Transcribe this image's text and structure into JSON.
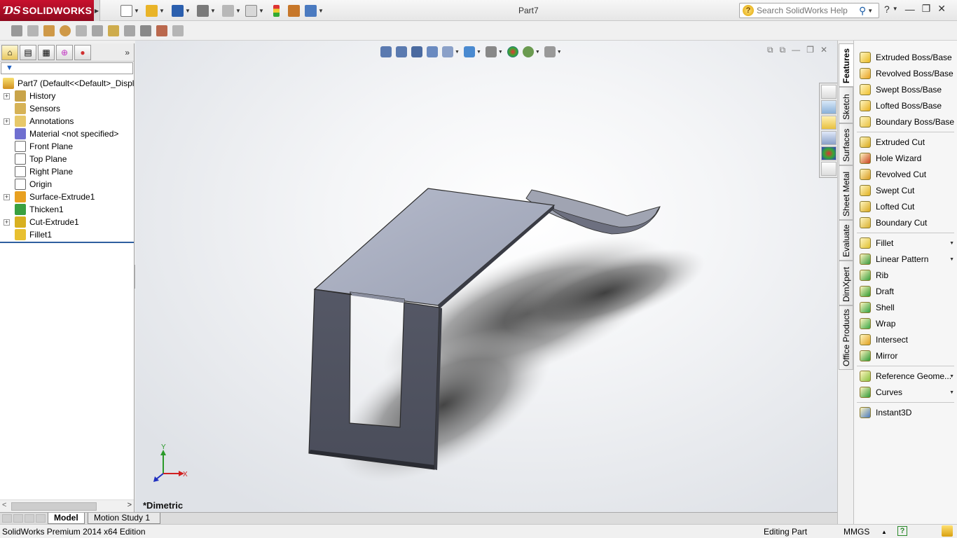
{
  "app": {
    "brand": "SOLIDWORKS",
    "document_title": "Part7",
    "search_placeholder": "Search SolidWorks Help"
  },
  "title_toolbar": [
    {
      "name": "new-document-icon",
      "color": "#ffffff"
    },
    {
      "name": "open-folder-icon",
      "color": "#e9b428"
    },
    {
      "name": "save-icon",
      "color": "#2b5fae"
    },
    {
      "name": "print-icon",
      "color": "#7a7a7a"
    },
    {
      "name": "undo-icon",
      "color": "#9a9a9a"
    },
    {
      "name": "select-cursor-icon",
      "color": "#d8d8d8"
    },
    {
      "name": "rebuild-traffic-light-icon",
      "color": "#3f9f3f"
    },
    {
      "name": "file-properties-icon",
      "color": "#c7772a"
    },
    {
      "name": "options-icon",
      "color": "#4a7ac0"
    }
  ],
  "feature_manager": {
    "tabs": [
      "feature-manager-tab",
      "property-manager-tab",
      "configuration-manager-tab",
      "dimxpert-manager-tab",
      "display-manager-tab"
    ],
    "root": "Part7  (Default<<Default>_Displ",
    "tree": [
      {
        "label": "History",
        "icon": "history-icon",
        "expandable": true,
        "color": "#c9a44a"
      },
      {
        "label": "Sensors",
        "icon": "sensors-icon",
        "expandable": false,
        "color": "#d6b256"
      },
      {
        "label": "Annotations",
        "icon": "annotations-icon",
        "expandable": true,
        "color": "#e7c86a"
      },
      {
        "label": "Material <not specified>",
        "icon": "material-icon",
        "expandable": false,
        "color": "#6f6fd0"
      },
      {
        "label": "Front Plane",
        "icon": "plane-icon",
        "expandable": false,
        "color": "#ffffff"
      },
      {
        "label": "Top Plane",
        "icon": "plane-icon",
        "expandable": false,
        "color": "#ffffff"
      },
      {
        "label": "Right Plane",
        "icon": "plane-icon",
        "expandable": false,
        "color": "#ffffff"
      },
      {
        "label": "Origin",
        "icon": "origin-icon",
        "expandable": false,
        "color": "#ffffff"
      },
      {
        "label": "Surface-Extrude1",
        "icon": "surface-extrude-icon",
        "expandable": true,
        "color": "#e8a020"
      },
      {
        "label": "Thicken1",
        "icon": "thicken-icon",
        "expandable": false,
        "color": "#3aa040"
      },
      {
        "label": "Cut-Extrude1",
        "icon": "cut-extrude-icon",
        "expandable": true,
        "color": "#d8b020"
      },
      {
        "label": "Fillet1",
        "icon": "fillet-icon",
        "expandable": false,
        "color": "#e8c030"
      }
    ]
  },
  "viewport": {
    "view_name": "*Dimetric",
    "triad": {
      "x": "X",
      "y": "Y"
    }
  },
  "bottom_tabs": [
    "Model",
    "Motion Study 1"
  ],
  "status_bar": {
    "edition": "SolidWorks Premium 2014 x64 Edition",
    "mode": "Editing Part",
    "units": "MMGS",
    "units_arrow": "▲",
    "help": "?"
  },
  "command_manager": {
    "tabs": [
      "Features",
      "Sketch",
      "Surfaces",
      "Sheet Metal",
      "Evaluate",
      "DimXpert",
      "Office Products"
    ],
    "active_tab": "Features",
    "groups": [
      [
        {
          "label": "Extruded Boss/Base",
          "icon": "extruded-boss-icon",
          "color": "#e8b820"
        },
        {
          "label": "Revolved Boss/Base",
          "icon": "revolved-boss-icon",
          "color": "#e8a020"
        },
        {
          "label": "Swept Boss/Base",
          "icon": "swept-boss-icon",
          "color": "#f0c030"
        },
        {
          "label": "Lofted Boss/Base",
          "icon": "lofted-boss-icon",
          "color": "#e8b020"
        },
        {
          "label": "Boundary Boss/Base",
          "icon": "boundary-boss-icon",
          "color": "#e8c040"
        }
      ],
      [
        {
          "label": "Extruded Cut",
          "icon": "extruded-cut-icon",
          "color": "#d8a818"
        },
        {
          "label": "Hole Wizard",
          "icon": "hole-wizard-icon",
          "color": "#c84020"
        },
        {
          "label": "Revolved Cut",
          "icon": "revolved-cut-icon",
          "color": "#d89a20"
        },
        {
          "label": "Swept Cut",
          "icon": "swept-cut-icon",
          "color": "#e0b020"
        },
        {
          "label": "Lofted Cut",
          "icon": "lofted-cut-icon",
          "color": "#d8a820"
        },
        {
          "label": "Boundary Cut",
          "icon": "boundary-cut-icon",
          "color": "#d8b030"
        }
      ],
      [
        {
          "label": "Fillet",
          "icon": "fillet-icon",
          "color": "#e0c030",
          "dropdown": true
        },
        {
          "label": "Linear Pattern",
          "icon": "linear-pattern-icon",
          "color": "#3a9a40",
          "dropdown": true
        },
        {
          "label": "Rib",
          "icon": "rib-icon",
          "color": "#3aa040"
        },
        {
          "label": "Draft",
          "icon": "draft-icon",
          "color": "#2f9a30"
        },
        {
          "label": "Shell",
          "icon": "shell-icon",
          "color": "#30a040"
        },
        {
          "label": "Wrap",
          "icon": "wrap-icon",
          "color": "#3aa848"
        },
        {
          "label": "Intersect",
          "icon": "intersect-icon",
          "color": "#e0a020"
        },
        {
          "label": "Mirror",
          "icon": "mirror-icon",
          "color": "#2f9a38"
        }
      ],
      [
        {
          "label": "Reference Geome...",
          "icon": "reference-geometry-icon",
          "color": "#8ac040",
          "dropdown": true
        },
        {
          "label": "Curves",
          "icon": "curves-icon",
          "color": "#2f9a38",
          "dropdown": true
        }
      ],
      [
        {
          "label": "Instant3D",
          "icon": "instant3d-icon",
          "color": "#4a7ac0"
        }
      ]
    ]
  }
}
